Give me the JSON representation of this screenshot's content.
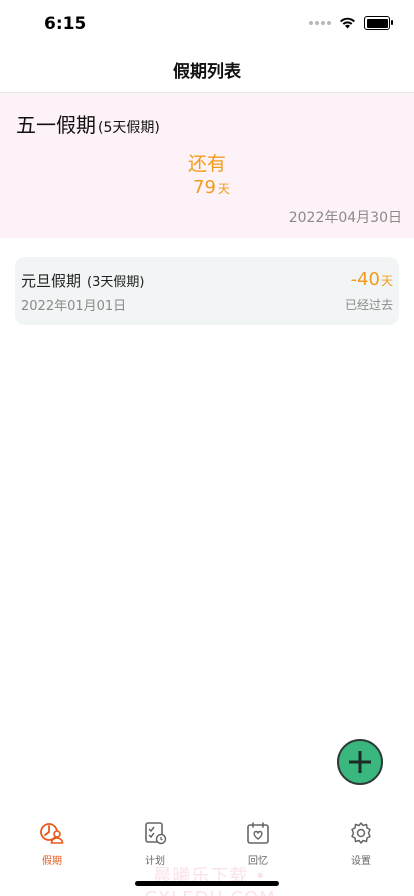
{
  "status_bar": {
    "time": "6:15"
  },
  "nav": {
    "title": "假期列表"
  },
  "featured_holiday": {
    "name": "五一假期",
    "days_text": "(5天假期)",
    "countdown_label": "还有",
    "countdown_value": "79",
    "countdown_unit": "天",
    "date": "2022年04月30日"
  },
  "holidays": [
    {
      "name": "元旦假期",
      "days_text": "(3天假期)",
      "date": "2022年01月01日",
      "count_value": "-40",
      "count_unit": "天",
      "status": "已经过去"
    }
  ],
  "fab": {
    "icon": "plus-icon"
  },
  "tabs": [
    {
      "label": "假期",
      "icon": "holiday-icon",
      "active": true
    },
    {
      "label": "计划",
      "icon": "plan-icon",
      "active": false
    },
    {
      "label": "回忆",
      "icon": "memory-icon",
      "active": false
    },
    {
      "label": "设置",
      "icon": "gear-icon",
      "active": false
    }
  ],
  "watermark": "晨曦乐下载 • CXLEDU.COM",
  "colors": {
    "accent_orange": "#f39b1a",
    "active_tab": "#e55a1b",
    "fab_green": "#3ab77f",
    "featured_bg": "#fdf2f8",
    "card_bg": "#f2f5f5"
  }
}
